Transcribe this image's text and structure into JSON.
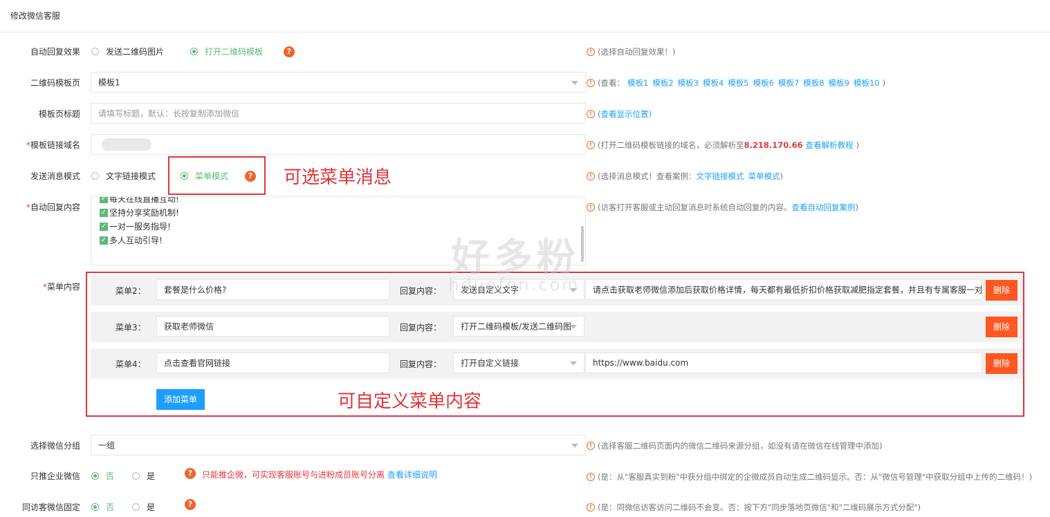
{
  "header": {
    "title": "修改微信客服"
  },
  "auto_reply_effect": {
    "label": "自动回复效果",
    "options": [
      "发送二维码图片",
      "打开二维码模板"
    ],
    "hint": "(选择自动回复效果！)"
  },
  "qr_template": {
    "label": "二维码模板页",
    "value": "模板1",
    "hint_prefix": "(查看：",
    "links": [
      "模板1",
      "模板2",
      "模板3",
      "模板4",
      "模板5",
      "模板6",
      "模板7",
      "模板8",
      "模板9",
      "模板10"
    ],
    "hint_suffix": ")"
  },
  "template_title": {
    "label": "模板页标题",
    "placeholder": "请填写标题，默认：长按复制添加微信",
    "hint_link": "(查看显示位置)"
  },
  "domain": {
    "label": "模板链接域名",
    "hint_prefix": "(打开二维码模板链接的域名，必须解析至",
    "hint_ip": "8.218.170.66",
    "hint_link": "查看解析教程",
    "hint_suffix": ")"
  },
  "send_mode": {
    "label": "发送消息模式",
    "options": [
      "文字链接模式",
      "菜单模式"
    ],
    "hint_prefix": "(选择消息模式！查看案例：",
    "links": [
      "文字链接模式",
      "菜单模式"
    ],
    "hint_suffix": ")"
  },
  "auto_reply_content": {
    "label": "自动回复内容",
    "lines": [
      "每天在线直播互动!",
      "坚持分享奖励机制!",
      "一对一服务指导!",
      "多人互动引导!"
    ],
    "hint": "(访客打开客服或主动回复消息时系统自动回复的内容。",
    "hint_link": "查看自动回复案例",
    "hint_suffix": ")"
  },
  "menu_content": {
    "label": "菜单内容",
    "reply_label": "回复内容：",
    "delete_label": "删除",
    "add_label": "添加菜单",
    "rows": [
      {
        "label": "菜单2：",
        "name": "套餐是什么价格?",
        "type": "发送自定义文字",
        "value": "请点击获取老师微信添加后获取价格详情，每天都有最低折扣价格获取减肥指定套餐，并且有专属客服一对"
      },
      {
        "label": "菜单3：",
        "name": "获取老师微信",
        "type": "打开二维码模板/发送二维码图",
        "value": ""
      },
      {
        "label": "菜单4：",
        "name": "点击查看官网链接",
        "type": "打开自定义链接",
        "value": "https://www.baidu.com"
      }
    ]
  },
  "wechat_group": {
    "label": "选择微信分组",
    "value": "一组",
    "hint": "(选择客服二维码页面内的微信二维码来源分组，如没有请在微信在线管理中添加)"
  },
  "only_enterprise": {
    "label": "只推企业微信",
    "options": [
      "否",
      "是"
    ],
    "note": "只能推企微，可实现客服账号与进粉成员账号分离",
    "note_link": "查看详细说明",
    "hint": "(是：从\"客服真实到粉\"中获分组中绑定的企微成员自动生成二维码显示。否：从\"微信号管理\"中获取分组中上传的二维码！)"
  },
  "same_visitor": {
    "label": "同访客微信固定",
    "options": [
      "否",
      "是"
    ],
    "hint": "(是：同微信访客访问二维码不会变。否：按下方\"同步落地页微信\"和\"二维码展示方式分配\")"
  },
  "annotations": {
    "menu_mode": "可选菜单消息",
    "custom_menu": "可自定义菜单内容"
  },
  "watermark": {
    "main": "好多粉",
    "sub": "hduofen.com"
  }
}
